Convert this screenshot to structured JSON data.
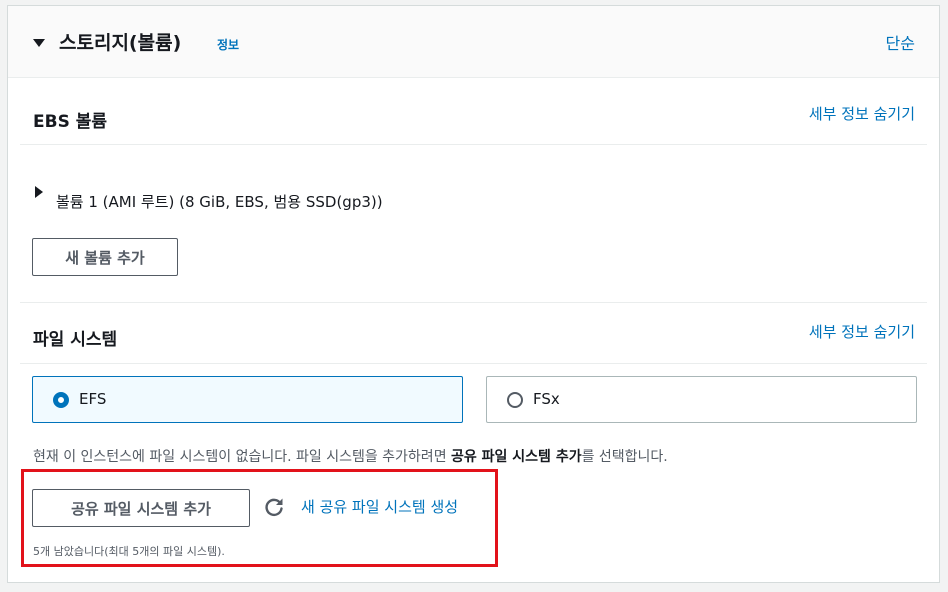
{
  "header": {
    "title": "스토리지(볼륨)",
    "info_link": "정보",
    "simple_link": "단순"
  },
  "ebs": {
    "title": "EBS 볼륨",
    "detail_link": "세부 정보 숨기기",
    "volume_label": "볼륨 1 (AMI 루트) (8 GiB, EBS, 범용 SSD(gp3))",
    "add_volume_button": "새 볼륨 추가"
  },
  "filesystem": {
    "title": "파일 시스템",
    "detail_link": "세부 정보 숨기기",
    "options": [
      {
        "label": "EFS",
        "selected": true
      },
      {
        "label": "FSx",
        "selected": false
      }
    ],
    "help_text_prefix": "현재 이 인스턴스에 파일 시스템이 없습니다. 파일 시스템을 추가하려면 ",
    "help_text_bold": "공유 파일 시스템 추가",
    "help_text_suffix": "를 선택합니다.",
    "add_shared_button": "공유 파일 시스템 추가",
    "create_link": "새 공유 파일 시스템 생성",
    "remaining_text": "5개 남았습니다(최대 5개의 파일 시스템)."
  },
  "colors": {
    "accent": "#0073bb",
    "highlight": "#e2121a",
    "text": "#16191f",
    "muted": "#545b64"
  },
  "icons": {
    "collapse": "caret-down-icon",
    "expand": "caret-right-icon",
    "refresh": "refresh-icon"
  }
}
